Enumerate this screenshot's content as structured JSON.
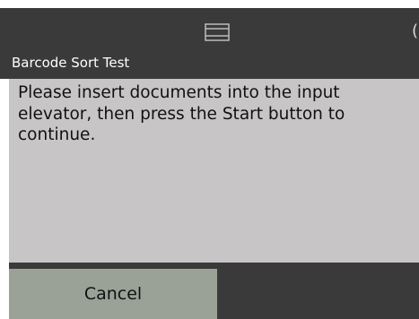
{
  "header": {
    "title": "Barcode Sort Test",
    "status_icon": "document-tray-icon",
    "edge_glyph": "("
  },
  "message": {
    "text": "Please insert documents into the input elevator, then press the Start button to continue."
  },
  "footer": {
    "cancel_label": "Cancel"
  },
  "colors": {
    "header_bg": "#3a3a3a",
    "panel_bg": "#c8c5c6",
    "button_bg": "#9aa298",
    "title_text": "#ffffff",
    "body_text": "#111111"
  }
}
